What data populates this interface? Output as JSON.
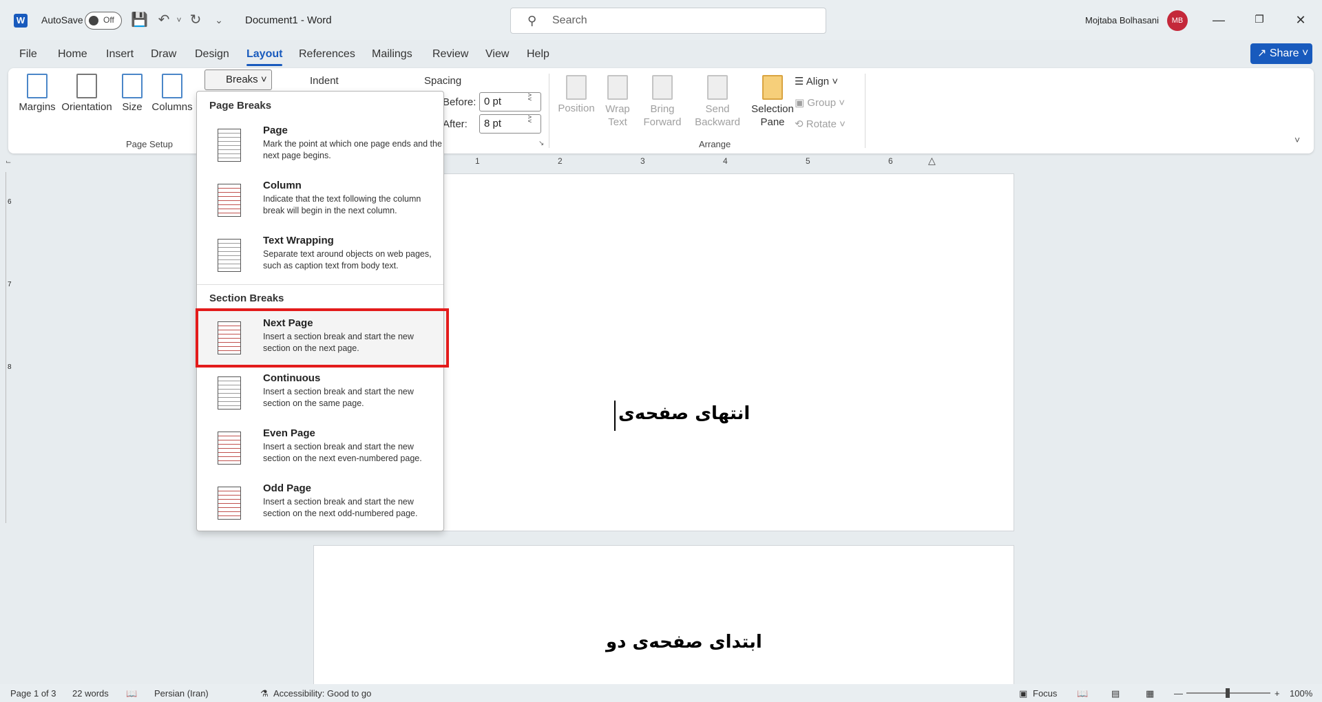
{
  "titlebar": {
    "autosave_label": "AutoSave",
    "autosave_state": "Off",
    "doc_title": "Document1  -  Word",
    "search_placeholder": "Search",
    "user_name": "Mojtaba Bolhasani",
    "user_initials": "MB"
  },
  "tabs": [
    "File",
    "Home",
    "Insert",
    "Draw",
    "Design",
    "Layout",
    "References",
    "Mailings",
    "Review",
    "View",
    "Help"
  ],
  "active_tab": "Layout",
  "share_label": "Share",
  "ribbon": {
    "page_setup": {
      "margins": "Margins",
      "orientation": "Orientation",
      "size": "Size",
      "columns": "Columns",
      "breaks": "Breaks",
      "group_label": "Page Setup"
    },
    "paragraph": {
      "indent_label": "Indent",
      "spacing_label": "Spacing",
      "before_label": "Before:",
      "before_value": "0 pt",
      "after_label": "After:",
      "after_value": "8 pt"
    },
    "arrange": {
      "position": "Position",
      "wrap_text_1": "Wrap",
      "wrap_text_2": "Text",
      "bring_forward_1": "Bring",
      "bring_forward_2": "Forward",
      "send_backward_1": "Send",
      "send_backward_2": "Backward",
      "selection_pane_1": "Selection",
      "selection_pane_2": "Pane",
      "align": "Align",
      "group": "Group",
      "rotate": "Rotate",
      "group_label": "Arrange"
    }
  },
  "ruler_numbers": [
    "1",
    "2",
    "3",
    "4",
    "5",
    "6"
  ],
  "ruler_v_numbers": [
    "6",
    "7",
    "8"
  ],
  "breaks_menu": {
    "page_breaks_header": "Page Breaks",
    "section_breaks_header": "Section Breaks",
    "items": [
      {
        "title": "Page",
        "desc": "Mark the point at which one page ends and the next page begins."
      },
      {
        "title": "Column",
        "desc": "Indicate that the text following the column break will begin in the next column."
      },
      {
        "title": "Text Wrapping",
        "desc": "Separate text around objects on web pages, such as caption text from body text."
      },
      {
        "title": "Next Page",
        "desc": "Insert a section break and start the new section on the next page."
      },
      {
        "title": "Continuous",
        "desc": "Insert a section break and start the new section on the same page."
      },
      {
        "title": "Even Page",
        "desc": "Insert a section break and start the new section on the next even-numbered page."
      },
      {
        "title": "Odd Page",
        "desc": "Insert a section break and start the new section on the next odd-numbered page."
      }
    ]
  },
  "document": {
    "page1_text": "انتهای صفحه‌ی",
    "page2_text": "ابتدای صفحه‌ی دو"
  },
  "status": {
    "page": "Page 1 of 3",
    "words": "22 words",
    "language": "Persian (Iran)",
    "accessibility": "Accessibility: Good to go",
    "focus": "Focus",
    "zoom": "100%"
  },
  "colors": {
    "accent": "#185abd",
    "highlight_frame": "#e31b1b"
  }
}
